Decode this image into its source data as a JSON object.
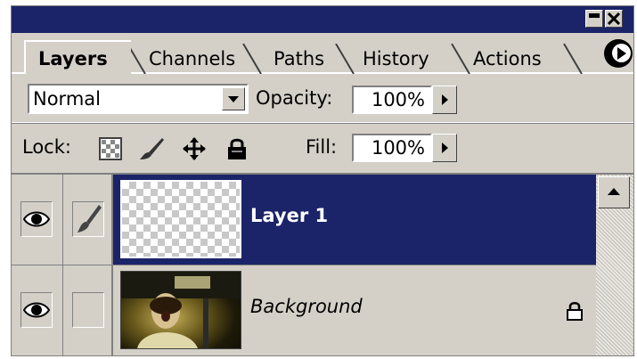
{
  "window": {
    "minimize_icon": "minimize-icon",
    "close_icon": "close-icon",
    "title_color": "#1b2468"
  },
  "tabs": [
    {
      "label": "Layers",
      "active": true
    },
    {
      "label": "Channels",
      "active": false
    },
    {
      "label": "Paths",
      "active": false
    },
    {
      "label": "History",
      "active": false
    },
    {
      "label": "Actions",
      "active": false
    }
  ],
  "panel_menu_icon": "panel-menu-arrow-icon",
  "blend": {
    "mode": "Normal"
  },
  "opacity": {
    "label": "Opacity:",
    "value": "100%"
  },
  "lock": {
    "label": "Lock:",
    "icons": [
      "lock-transparency-icon",
      "lock-image-icon",
      "lock-position-icon",
      "lock-all-icon"
    ]
  },
  "fill": {
    "label": "Fill:",
    "value": "100%"
  },
  "layers": [
    {
      "name": "Layer 1",
      "selected": true,
      "visible": true,
      "brush": true,
      "locked": false
    },
    {
      "name": "Background",
      "selected": false,
      "visible": true,
      "brush": false,
      "locked": true
    }
  ],
  "selection_color": "#1b2468"
}
